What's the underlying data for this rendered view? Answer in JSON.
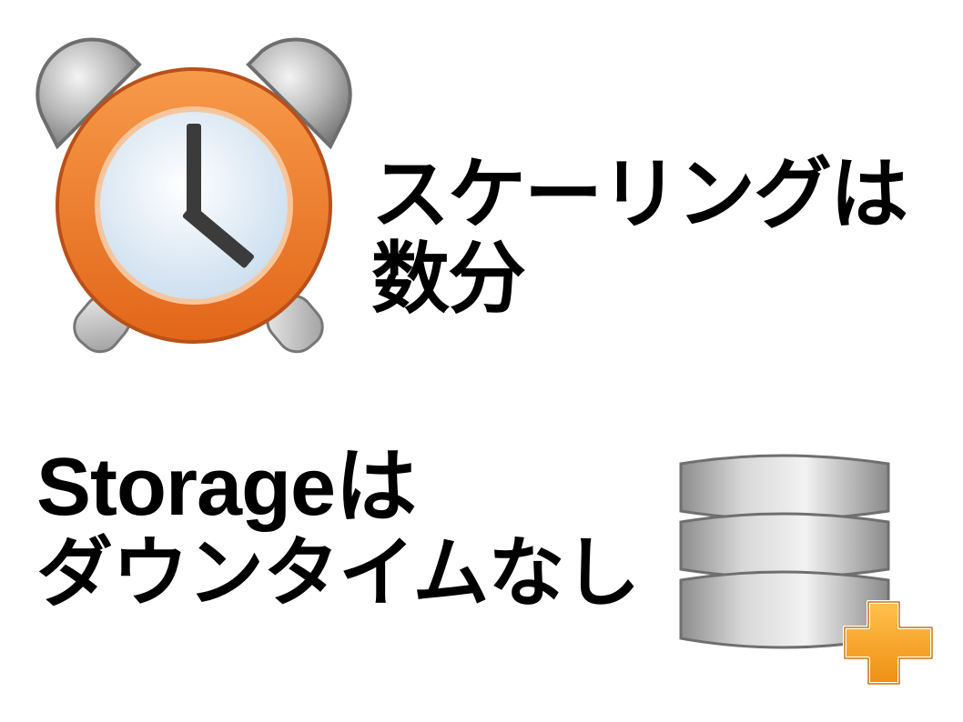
{
  "slide": {
    "top": {
      "icon": "alarm-clock-icon",
      "line1": "スケーリングは",
      "line2": "数分"
    },
    "bottom": {
      "icon": "database-add-icon",
      "line1": "Storageは",
      "line2": "ダウンタイムなし"
    }
  },
  "colors": {
    "clock_orange": "#f07a22",
    "clock_face": "#dbe9f5",
    "bell_gray": "#a9a9a9",
    "db_gray": "#9c9c9c",
    "plus_orange": "#f5a623"
  }
}
